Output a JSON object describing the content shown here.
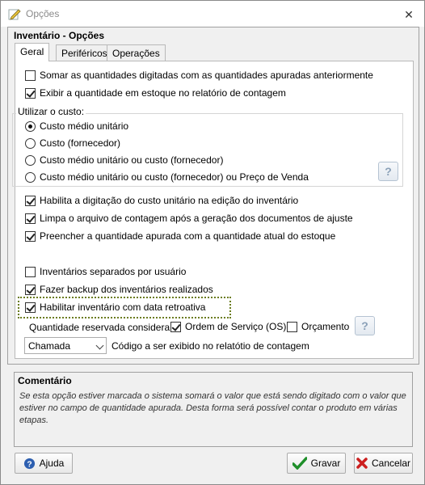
{
  "window": {
    "title": "Opções"
  },
  "panel": {
    "title": "Inventário - Opções"
  },
  "tabs": [
    {
      "label": "Geral"
    },
    {
      "label": "Periféricos"
    },
    {
      "label": "Operações"
    }
  ],
  "options": {
    "somar": {
      "label": "Somar as quantidades digitadas com as quantidades apuradas anteriormente",
      "checked": false
    },
    "exibir": {
      "label": "Exibir a quantidade em estoque no relatório de contagem",
      "checked": true
    },
    "habilita_custo": {
      "label": "Habilita a digitação do custo unitário na edição do inventário",
      "checked": true
    },
    "limpa": {
      "label": "Limpa o arquivo de contagem após a geração dos documentos de ajuste",
      "checked": true
    },
    "preencher": {
      "label": "Preencher a quantidade apurada com a quantidade atual do estoque",
      "checked": true
    },
    "separados": {
      "label": "Inventários separados por usuário",
      "checked": false
    },
    "backup": {
      "label": "Fazer backup dos inventários realizados",
      "checked": true
    },
    "retroativa": {
      "label": "Habilitar inventário com data retroativa",
      "checked": true
    }
  },
  "custo": {
    "title": "Utilizar o custo:",
    "options": [
      {
        "label": "Custo médio unitário",
        "selected": true
      },
      {
        "label": "Custo (fornecedor)",
        "selected": false
      },
      {
        "label": "Custo médio unitário ou custo (fornecedor)",
        "selected": false
      },
      {
        "label": "Custo médio unitário ou custo (fornecedor) ou Preço de Venda",
        "selected": false
      }
    ]
  },
  "reservada": {
    "label": "Quantidade reservada considera:",
    "os": {
      "label": "Ordem de Serviço (OS)",
      "checked": true
    },
    "orcamento": {
      "label": "Orçamento",
      "checked": false
    }
  },
  "codigo": {
    "selected": "Chamada",
    "label": "Código a ser exibido no relatótio de contagem"
  },
  "comentario": {
    "title": "Comentário",
    "text": "Se esta opção estiver marcada o sistema somará o valor que está sendo digitado com o valor que estiver no campo de quantidade apurada. Desta forma será possível contar o produto em várias etapas."
  },
  "buttons": {
    "help_glyph": "?",
    "ajuda": "Ajuda",
    "gravar": "Gravar",
    "cancelar": "Cancelar"
  },
  "icons": {
    "app": "edit-note-icon",
    "close": "close-icon",
    "help": "question-help-icon",
    "save": "green-check-icon",
    "cancel": "red-x-icon"
  }
}
